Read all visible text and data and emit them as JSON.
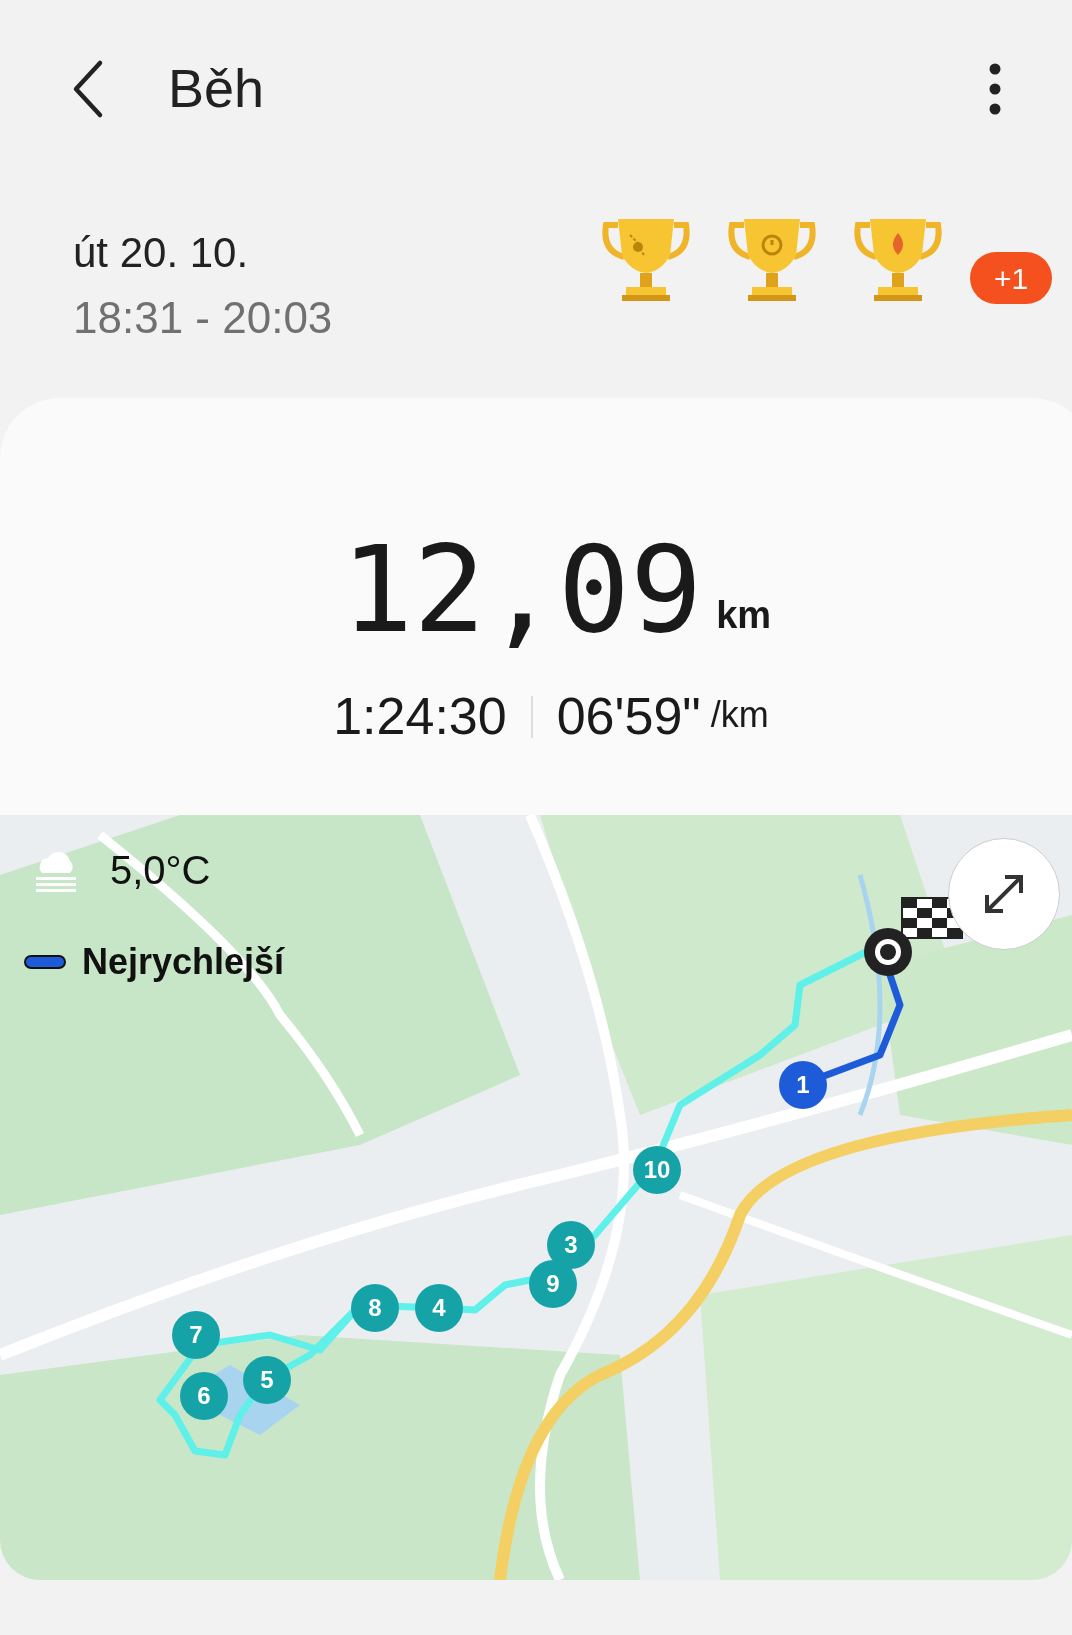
{
  "header": {
    "title": "Běh"
  },
  "summary": {
    "date": "út 20. 10.",
    "time_range": "18:31 - 20:03",
    "extra_awards": "+1"
  },
  "stats": {
    "distance": "12,09",
    "distance_unit": "km",
    "duration": "1:24:30",
    "pace": "06'59\"",
    "pace_unit": "/km"
  },
  "map": {
    "kind": "picture",
    "temperature": "5,0°C",
    "legend": {
      "label": "Nejrychlejší",
      "color": "#1e5bd8"
    },
    "markers": [
      {
        "label": "1",
        "fastest": true
      },
      {
        "label": "10",
        "fastest": false
      },
      {
        "label": "3",
        "fastest": false
      },
      {
        "label": "9",
        "fastest": false
      },
      {
        "label": "8",
        "fastest": false
      },
      {
        "label": "4",
        "fastest": false
      },
      {
        "label": "7",
        "fastest": false
      },
      {
        "label": "6",
        "fastest": false
      },
      {
        "label": "5",
        "fastest": false
      }
    ]
  }
}
